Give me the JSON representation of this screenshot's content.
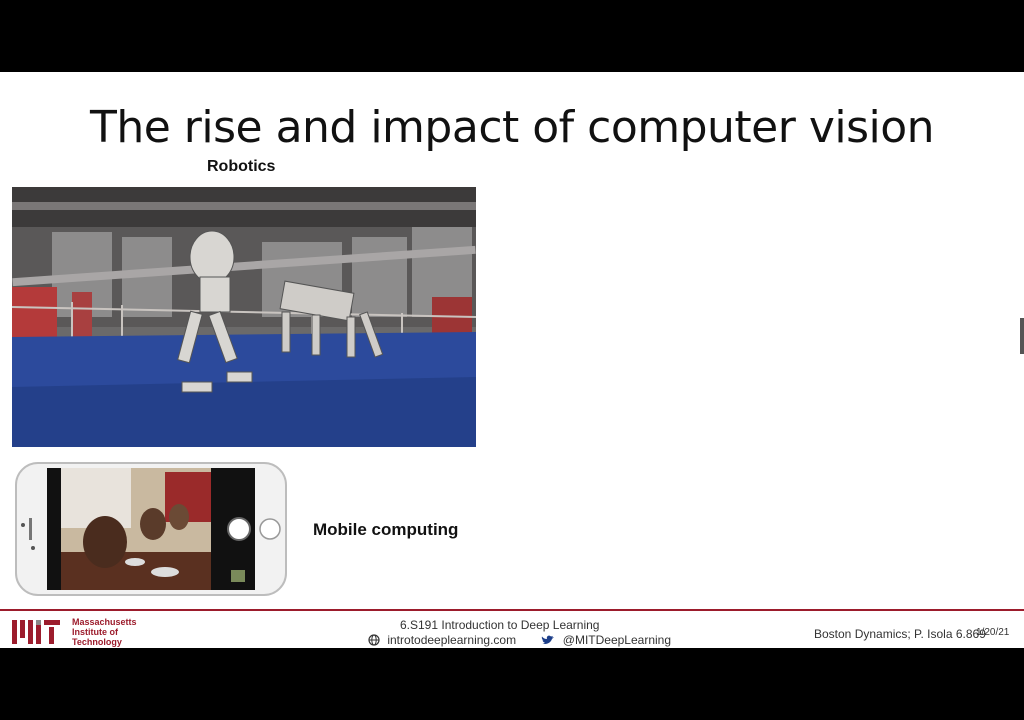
{
  "slide": {
    "title": "The rise and impact of computer vision",
    "labels": {
      "robotics": "Robotics",
      "mobile": "Mobile computing"
    }
  },
  "footer": {
    "institution": [
      "Massachusetts",
      "Institute of",
      "Technology"
    ],
    "course": "6.S191 Introduction to Deep Learning",
    "website": "introtodeeplearning.com",
    "twitter": "@MITDeepLearning",
    "credit": "Boston Dynamics; P. Isola 6.869",
    "date": "1/20/21"
  },
  "colors": {
    "mit_red": "#9c1c2c",
    "floor_blue": "#2c4a9c",
    "twitter_blue": "#1d3f8a"
  },
  "icons": [
    "globe-icon",
    "twitter-bird-icon",
    "camera-shutter-icon",
    "home-button-icon"
  ]
}
